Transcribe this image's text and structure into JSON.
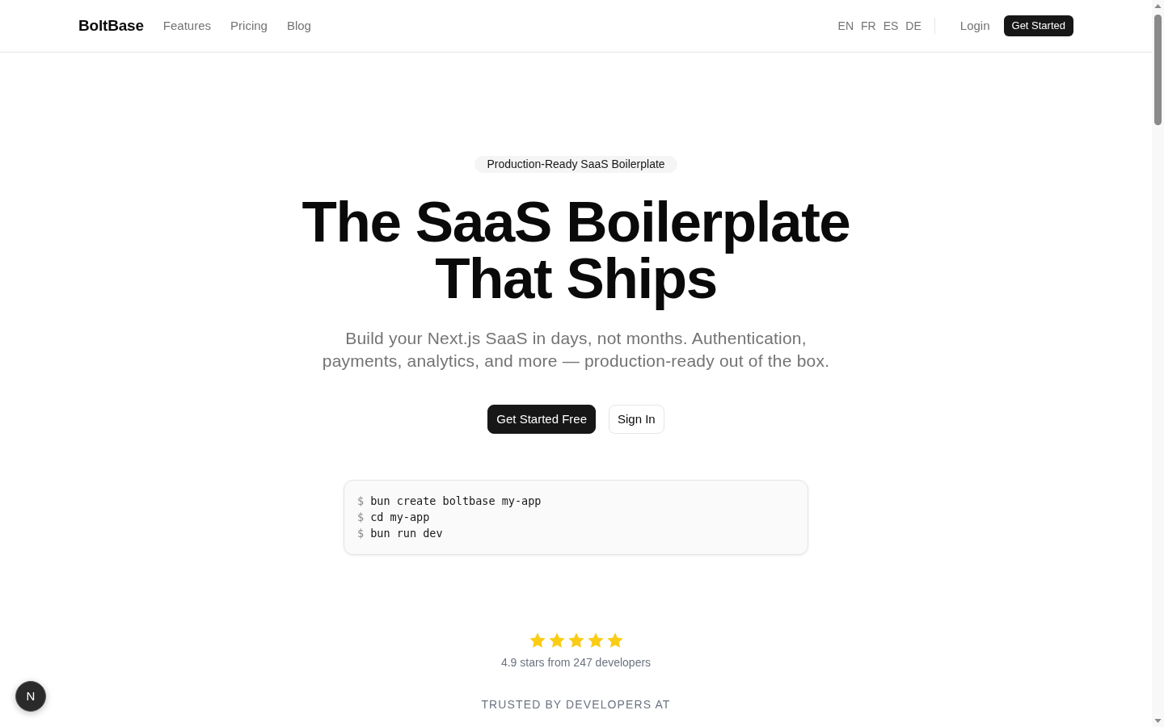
{
  "header": {
    "brand": "BoltBase",
    "nav": [
      "Features",
      "Pricing",
      "Blog"
    ],
    "languages": [
      "EN",
      "FR",
      "ES",
      "DE"
    ],
    "login": "Login",
    "cta": "Get Started"
  },
  "hero": {
    "badge": "Production-Ready SaaS Boilerplate",
    "title_lines": [
      "The SaaS Boilerplate",
      "That Ships"
    ],
    "subtitle_lines": [
      "Build your Next.js SaaS in days, not months. Authentication,",
      "payments, analytics, and more — production-ready out of the box."
    ],
    "buttons": [
      {
        "label": "Get Started Free",
        "kind": "primary"
      },
      {
        "label": "Sign In",
        "kind": "secondary"
      }
    ],
    "terminal": [
      {
        "prompt": "$",
        "command": "bun create boltbase my-app"
      },
      {
        "prompt": "$",
        "command": "cd my-app"
      },
      {
        "prompt": "$",
        "command": "bun run dev"
      }
    ]
  },
  "rating": {
    "stars": 5,
    "text": "4.9 stars from 247 developers"
  },
  "trusted": {
    "heading": "TRUSTED BY DEVELOPERS AT"
  },
  "dev_badge": {
    "label": "N"
  }
}
